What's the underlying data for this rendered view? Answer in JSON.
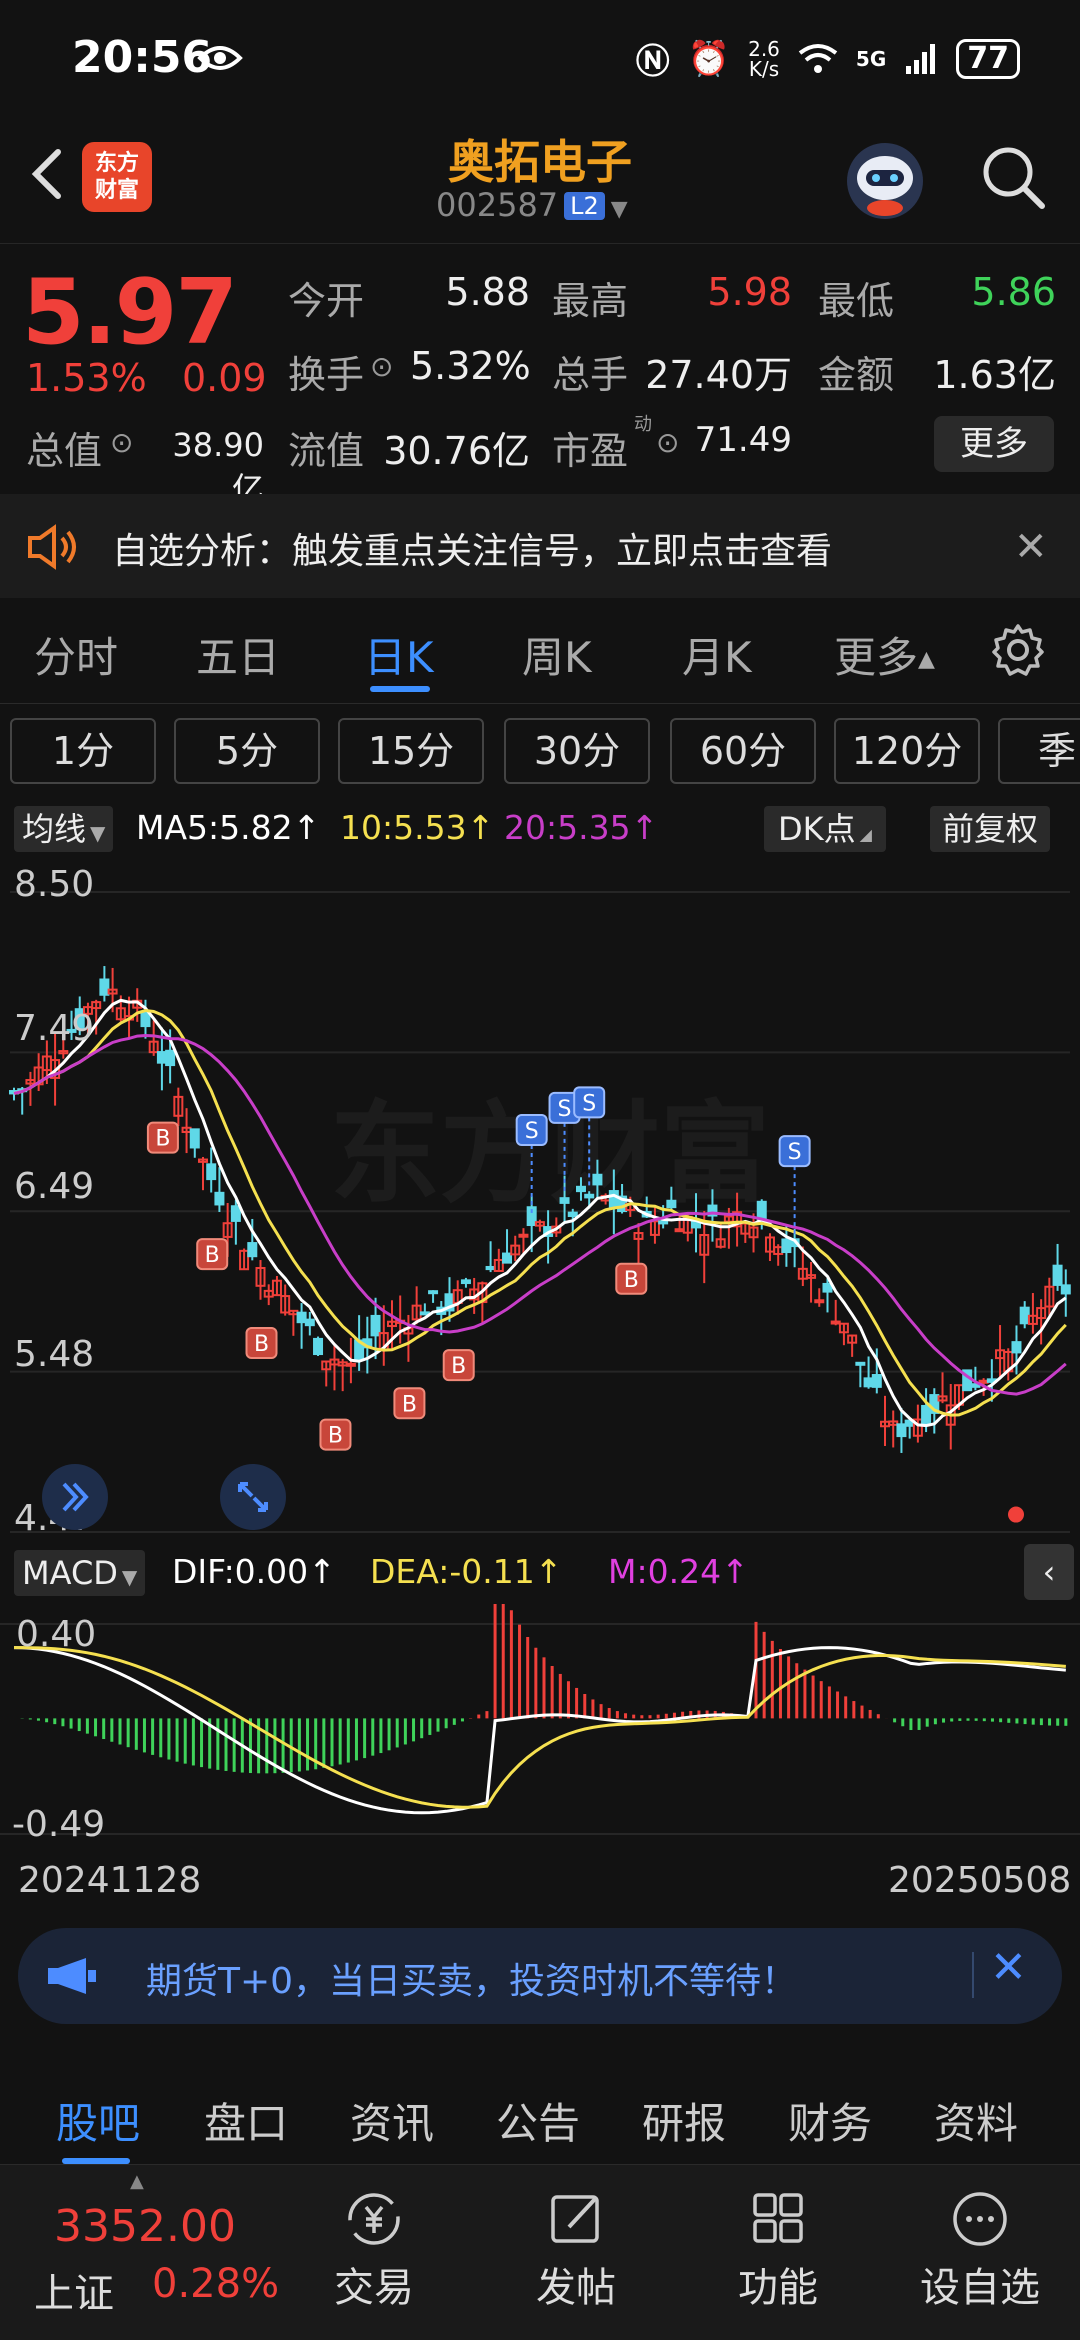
{
  "status": {
    "time": "20:56",
    "net_speed": "2.6\nK/s",
    "signal": "5G",
    "battery": "77"
  },
  "header": {
    "name": "奥拓电子",
    "code": "002587",
    "level": "L2",
    "logo": "东方\n财富"
  },
  "quote": {
    "price": "5.97",
    "pct": "1.53%",
    "change": "0.09",
    "open_label": "今开",
    "open": "5.88",
    "high_label": "最高",
    "high": "5.98",
    "low_label": "最低",
    "low": "5.86",
    "turnover_label": "换手",
    "turnover": "5.32%",
    "volume_label": "总手",
    "volume": "27.40万",
    "amount_label": "金额",
    "amount": "1.63亿",
    "mcap_label": "总值",
    "mcap": "38.90亿",
    "float_label": "流值",
    "float_cap": "30.76亿",
    "pe_label": "市盈",
    "pe_sup": "动",
    "pe": "71.49",
    "more": "更多"
  },
  "notice": {
    "text": "自选分析：触发重点关注信号，立即点击查看"
  },
  "period_tabs": [
    "分时",
    "五日",
    "日K",
    "周K",
    "月K",
    "更多"
  ],
  "minute_chips": [
    "1分",
    "5分",
    "15分",
    "30分",
    "60分",
    "120分",
    "季"
  ],
  "ma": {
    "selector": "均线",
    "ma5": "MA5:5.82↑",
    "ma10": "10:5.53↑",
    "ma20": "20:5.35↑",
    "dk": "DK点",
    "adjust": "前复权"
  },
  "colors": {
    "up": "#f0403a",
    "down": "#5fd8e8",
    "ma5": "#ffffff",
    "ma10": "#f5e050",
    "ma20": "#c83ec8",
    "accent": "#3d8fff"
  },
  "kchart": {
    "y_labels": [
      "8.50",
      "7.49",
      "6.49",
      "5.48",
      "4.47"
    ],
    "watermark": "东方财富",
    "buy_mark": "B",
    "sell_mark": "S"
  },
  "macd": {
    "selector": "MACD",
    "dif": "DIF:0.00↑",
    "dea": "DEA:-0.11↑",
    "m": "M:0.24↑",
    "y_top": "0.40",
    "y_bottom": "-0.49"
  },
  "dates": {
    "start": "20241128",
    "end": "20250508"
  },
  "promo": {
    "text": "期货T+0，当日买卖，投资时机不等待！"
  },
  "info_tabs": [
    "股吧",
    "盘口",
    "资讯",
    "公告",
    "研报",
    "财务",
    "资料"
  ],
  "bottom": {
    "index_value": "3352.00",
    "index_name": "上证",
    "index_pct": "0.28%",
    "items": [
      "交易",
      "发帖",
      "功能",
      "设自选"
    ]
  },
  "chart_data": {
    "type": "candlestick",
    "title": "",
    "x_range": [
      "20241128",
      "20250508"
    ],
    "ylim": [
      4.47,
      8.5
    ],
    "y_ticks": [
      8.5,
      7.49,
      6.49,
      5.48,
      4.47
    ],
    "closes_approx": [
      7.3,
      7.5,
      7.7,
      7.9,
      7.8,
      7.6,
      7.2,
      6.8,
      6.5,
      6.2,
      6.0,
      5.8,
      5.6,
      5.5,
      5.7,
      5.8,
      5.9,
      5.9,
      6.0,
      6.2,
      6.3,
      6.4,
      6.5,
      6.6,
      6.5,
      6.4,
      6.5,
      6.4,
      6.4,
      6.5,
      6.4,
      6.2,
      6.0,
      5.8,
      5.4,
      5.1,
      5.2,
      5.3,
      5.4,
      5.5,
      5.6,
      5.9,
      6.0
    ],
    "ma_latest": {
      "MA5": 5.82,
      "MA10": 5.53,
      "MA20": 5.35
    },
    "macd_latest": {
      "DIF": 0.0,
      "DEA": -0.11,
      "M": 0.24
    },
    "macd_range": [
      -0.49,
      0.4
    ]
  }
}
